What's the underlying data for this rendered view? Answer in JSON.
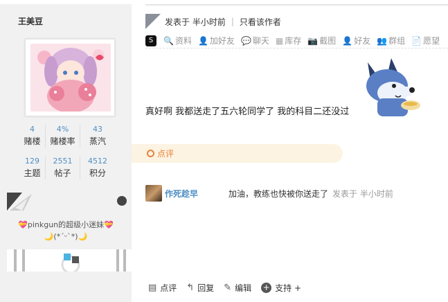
{
  "user": {
    "name": "王美豆",
    "stats_row1": [
      {
        "value": "4",
        "label": "赌楼"
      },
      {
        "value": "4%",
        "label": "赌楼率"
      },
      {
        "value": "43",
        "label": "蒸汽"
      }
    ],
    "stats_row2": [
      {
        "value": "129",
        "label": "主题"
      },
      {
        "value": "2551",
        "label": "帖子"
      },
      {
        "value": "4512",
        "label": "积分"
      }
    ],
    "signature_line1": "💝pinkgun的超级小迷妹💝",
    "signature_line2": "🌙(*ˊᵕˋ*)🌙"
  },
  "post": {
    "posted_at": "发表于 半小时前",
    "only_author": "只看该作者",
    "tools": [
      "资料",
      "加好友",
      "聊天",
      "库存",
      "截图",
      "好友",
      "群组",
      "愿望"
    ],
    "body": "真好啊 我都送走了五六轮同学了 我的科目二还没过"
  },
  "rate_label": "点评",
  "comment": {
    "user": "作死趁早",
    "text": "加油，教练也快被你送走了",
    "time": "发表于 半小时前"
  },
  "actions": {
    "rate": "点评",
    "reply": "回复",
    "edit": "编辑",
    "support": "支持 +"
  },
  "colors": {
    "link": "#4f8ec4",
    "rate_accent": "#e8823a",
    "rate_bg": "#fdf3e2",
    "sidebar_bg": "#f1f1f1"
  }
}
